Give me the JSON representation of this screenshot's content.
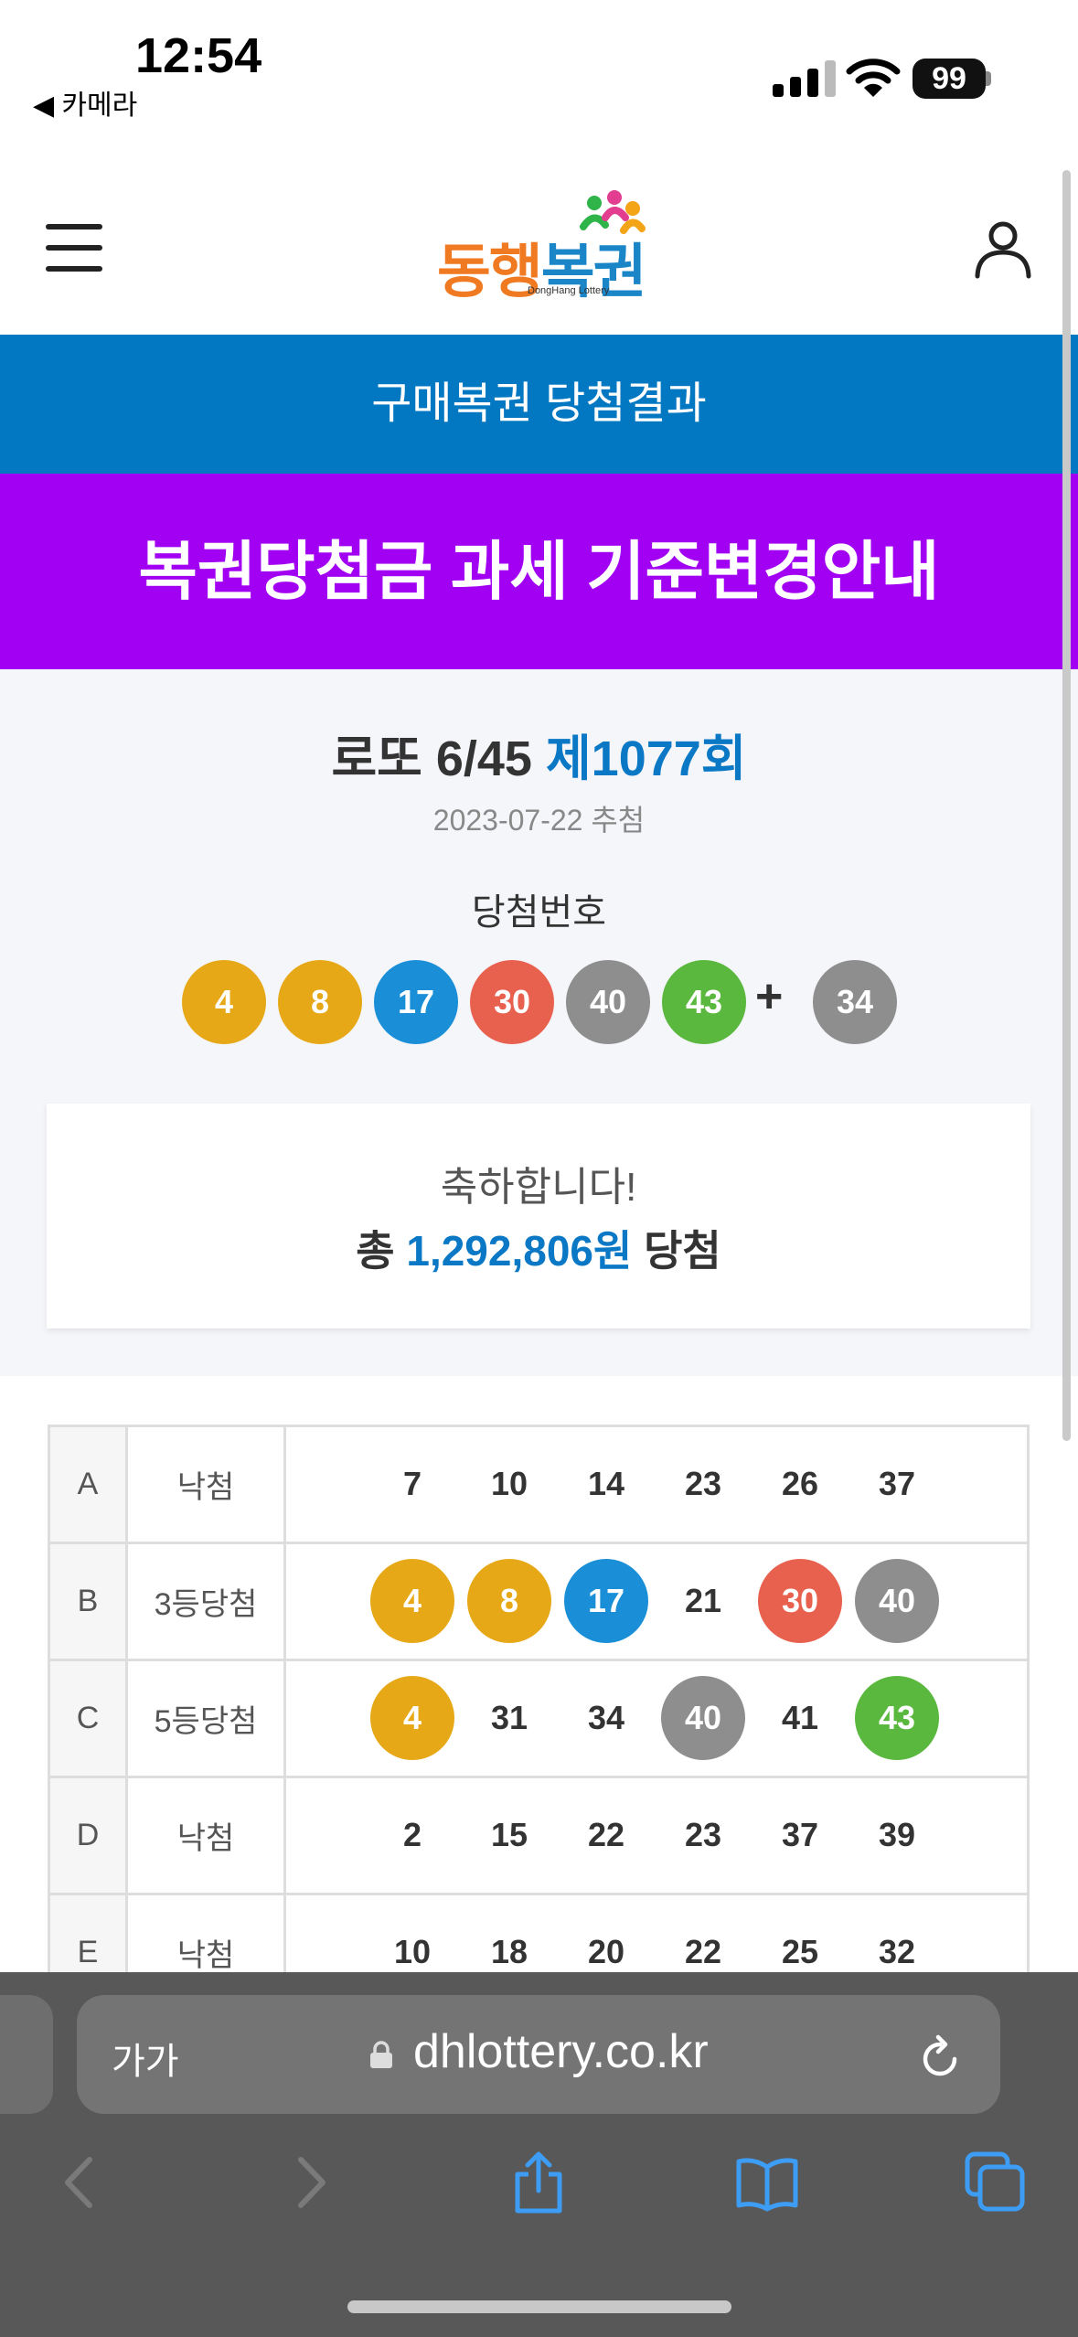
{
  "status_bar": {
    "time": "12:54",
    "back_app": "◀ 카메라",
    "battery": "99"
  },
  "header": {
    "logo_text_a": "동행",
    "logo_text_b": "복권",
    "logo_sub": "DongHang Lottery"
  },
  "banner_blue": "구매복권 당첨결과",
  "banner_purple": "복권당첨금 과세 기준변경안내",
  "result": {
    "game": "로또 6/45",
    "round": "제1077회",
    "draw_date": "2023-07-22 추첨",
    "winning_label": "당첨번호",
    "winning_numbers": [
      {
        "n": "4",
        "color": "#e6a817"
      },
      {
        "n": "8",
        "color": "#e6a817"
      },
      {
        "n": "17",
        "color": "#1a8fd8"
      },
      {
        "n": "30",
        "color": "#e8614e"
      },
      {
        "n": "40",
        "color": "#8e8e8e"
      },
      {
        "n": "43",
        "color": "#5ab83e"
      }
    ],
    "plus": "+",
    "bonus": {
      "n": "34",
      "color": "#8e8e8e"
    },
    "congrats": "축하합니다!",
    "total_prefix": "총",
    "total_amount": "1,292,806원",
    "total_suffix": "당첨"
  },
  "rows": [
    {
      "label": "A",
      "status": "낙첨",
      "nums": [
        {
          "n": "7"
        },
        {
          "n": "10"
        },
        {
          "n": "14"
        },
        {
          "n": "23"
        },
        {
          "n": "26"
        },
        {
          "n": "37"
        }
      ]
    },
    {
      "label": "B",
      "status": "3등당첨",
      "nums": [
        {
          "n": "4",
          "color": "#e6a817"
        },
        {
          "n": "8",
          "color": "#e6a817"
        },
        {
          "n": "17",
          "color": "#1a8fd8"
        },
        {
          "n": "21"
        },
        {
          "n": "30",
          "color": "#e8614e"
        },
        {
          "n": "40",
          "color": "#8e8e8e"
        }
      ]
    },
    {
      "label": "C",
      "status": "5등당첨",
      "nums": [
        {
          "n": "4",
          "color": "#e6a817"
        },
        {
          "n": "31"
        },
        {
          "n": "34"
        },
        {
          "n": "40",
          "color": "#8e8e8e"
        },
        {
          "n": "41"
        },
        {
          "n": "43",
          "color": "#5ab83e"
        }
      ]
    },
    {
      "label": "D",
      "status": "낙첨",
      "nums": [
        {
          "n": "2"
        },
        {
          "n": "15"
        },
        {
          "n": "22"
        },
        {
          "n": "23"
        },
        {
          "n": "37"
        },
        {
          "n": "39"
        }
      ]
    },
    {
      "label": "E",
      "status": "낙첨",
      "nums": [
        {
          "n": "10"
        },
        {
          "n": "18"
        },
        {
          "n": "20"
        },
        {
          "n": "22"
        },
        {
          "n": "25"
        },
        {
          "n": "32"
        }
      ]
    }
  ],
  "browser": {
    "text_size": "가가",
    "url": "dhlottery.co.kr"
  }
}
